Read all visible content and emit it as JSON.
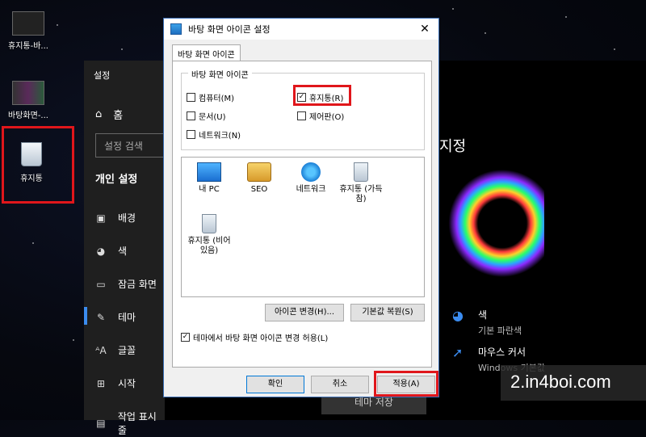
{
  "desktop": {
    "icons": [
      {
        "label": "휴지통-바..."
      },
      {
        "label": "바탕화면-..."
      },
      {
        "label": "휴지통"
      }
    ]
  },
  "settings": {
    "title": "설정",
    "home": "홈",
    "search_placeholder": "설정 검색",
    "section": "개인 설정",
    "nav": [
      "배경",
      "색",
      "잠금 화면",
      "테마",
      "글꼴",
      "시작",
      "작업 표시줄"
    ],
    "heading_fragment": "지정",
    "options": [
      {
        "title": "색",
        "subtitle": "기본 파란색"
      },
      {
        "title": "마우스 커서",
        "subtitle": "Windows 기본값"
      }
    ],
    "theme_button": "테마 저장"
  },
  "dialog": {
    "title": "바탕 화면 아이콘 설정",
    "tab": "바탕 화면 아이콘",
    "group_label": "바탕 화면 아이콘",
    "checkboxes": [
      {
        "label": "컴퓨터(M)",
        "checked": false
      },
      {
        "label": "휴지통(R)",
        "checked": true
      },
      {
        "label": "문서(U)",
        "checked": false
      },
      {
        "label": "제어판(O)",
        "checked": false
      },
      {
        "label": "네트워크(N)",
        "checked": false
      }
    ],
    "list_icons": [
      {
        "label": "내 PC",
        "icon": "pc-icon"
      },
      {
        "label": "SEO",
        "icon": "user-folder-icon"
      },
      {
        "label": "네트워크",
        "icon": "network-icon"
      },
      {
        "label": "휴지통 (가득 참)",
        "icon": "recycle-bin-full-icon"
      },
      {
        "label": "휴지통 (비어 있음)",
        "icon": "recycle-bin-empty-icon"
      }
    ],
    "change_icon": "아이콘 변경(H)...",
    "restore_default": "기본값 복원(S)",
    "allow_themes": "테마에서 바탕 화면 아이콘 변경 허용(L)",
    "allow_checked": true,
    "ok": "확인",
    "cancel": "취소",
    "apply": "적용(A)"
  },
  "watermark": "2.in4boi.com",
  "colors": {
    "highlight": "#e0161b",
    "accent": "#3b8cf0"
  }
}
